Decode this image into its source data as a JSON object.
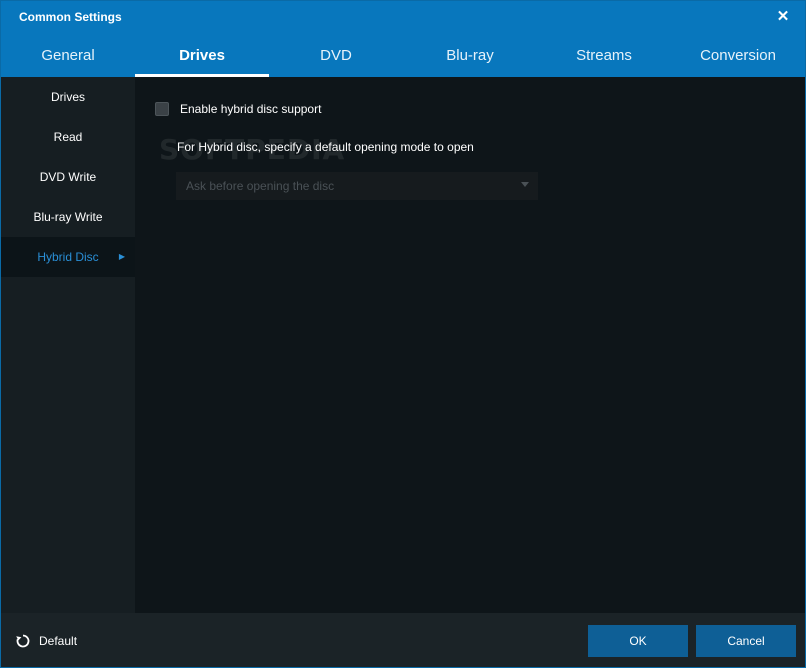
{
  "window": {
    "title": "Common Settings",
    "close_glyph": "✕"
  },
  "tabs": [
    {
      "label": "General"
    },
    {
      "label": "Drives"
    },
    {
      "label": "DVD"
    },
    {
      "label": "Blu-ray"
    },
    {
      "label": "Streams"
    },
    {
      "label": "Conversion"
    }
  ],
  "active_tab": "Drives",
  "sidebar": {
    "items": [
      {
        "label": "Drives"
      },
      {
        "label": "Read"
      },
      {
        "label": "DVD Write"
      },
      {
        "label": "Blu-ray Write"
      },
      {
        "label": "Hybrid Disc"
      }
    ],
    "active_item": "Hybrid Disc",
    "arrow_glyph": "▶"
  },
  "content": {
    "checkbox_label": "Enable hybrid disc support",
    "checkbox_checked": false,
    "description": "For Hybrid disc, specify a default opening mode to open",
    "select_value": "Ask before opening the disc",
    "watermark": "SOFTPEDIA"
  },
  "footer": {
    "default_label": "Default",
    "ok_label": "OK",
    "cancel_label": "Cancel"
  },
  "colors": {
    "accent": "#0877bd",
    "active_sidebar_text": "#2a8fd6",
    "button": "#0e5f96",
    "background": "#0e1519"
  }
}
